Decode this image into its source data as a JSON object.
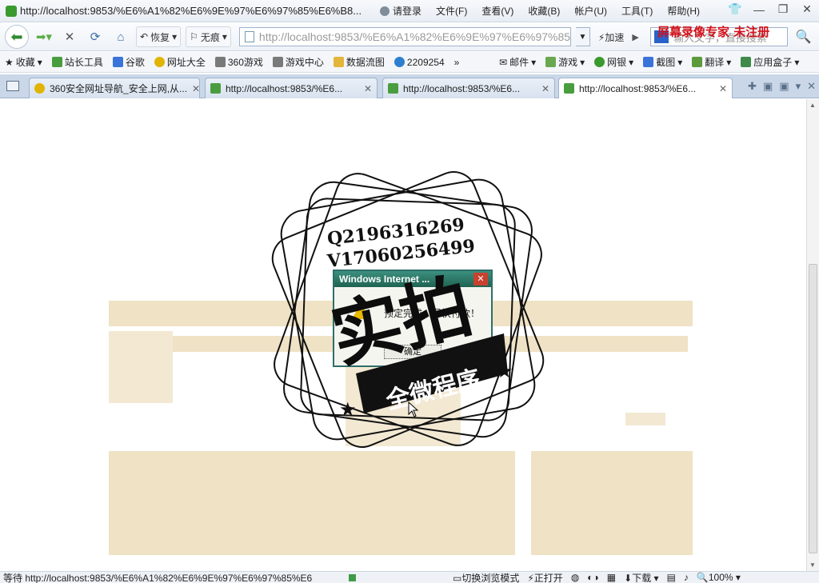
{
  "titlebar": {
    "title": "http://localhost:9853/%E6%A1%82%E6%9E%97%E6%97%85%E6%B8...",
    "login": "请登录",
    "menu": [
      "文件(F)",
      "查看(V)",
      "收藏(B)",
      "帐户(U)",
      "工具(T)",
      "帮助(H)"
    ]
  },
  "navbar": {
    "restore": "恢复",
    "nohistory": "无痕",
    "url": "http://localhost:9853/%E6%A1%82%E6%9E%97%E6%97%85%E6%",
    "accelerate": "加速",
    "search_placeholder": "输入文字，直接搜索"
  },
  "watermark": "屏幕录像专家 未注册",
  "favorites": {
    "left": [
      "收藏",
      "站长工具",
      "谷歌",
      "网址大全",
      "360游戏",
      "游戏中心",
      "数据流图",
      "2209254"
    ],
    "more": "»",
    "right": [
      "邮件",
      "游戏",
      "网银",
      "截图",
      "翻译",
      "应用盒子"
    ]
  },
  "tabs": [
    {
      "title": "360安全网址导航_安全上网,从..."
    },
    {
      "title": "http://localhost:9853/%E6..."
    },
    {
      "title": "http://localhost:9853/%E6..."
    },
    {
      "title": "http://localhost:9853/%E6..."
    }
  ],
  "dialog": {
    "title": "Windows Internet ...",
    "message": "预定完成，尽快付款！",
    "ok": "确定"
  },
  "stamp": {
    "line1": "Q2196316269",
    "line2": "V17060256499",
    "big": "实拍",
    "banner": "全微程序"
  },
  "statusbar": {
    "text": "等待 http://localhost:9853/%E6%A1%82%E6%9E%97%E6%97%85%E6",
    "switch_mode": "切换浏览模式",
    "opened": "正打开",
    "download": "下载",
    "zoom": "100%"
  },
  "colors": {
    "page_block": "#efe2c5",
    "dialog_title": "#2f6f6a",
    "watermark": "#d1121b"
  }
}
